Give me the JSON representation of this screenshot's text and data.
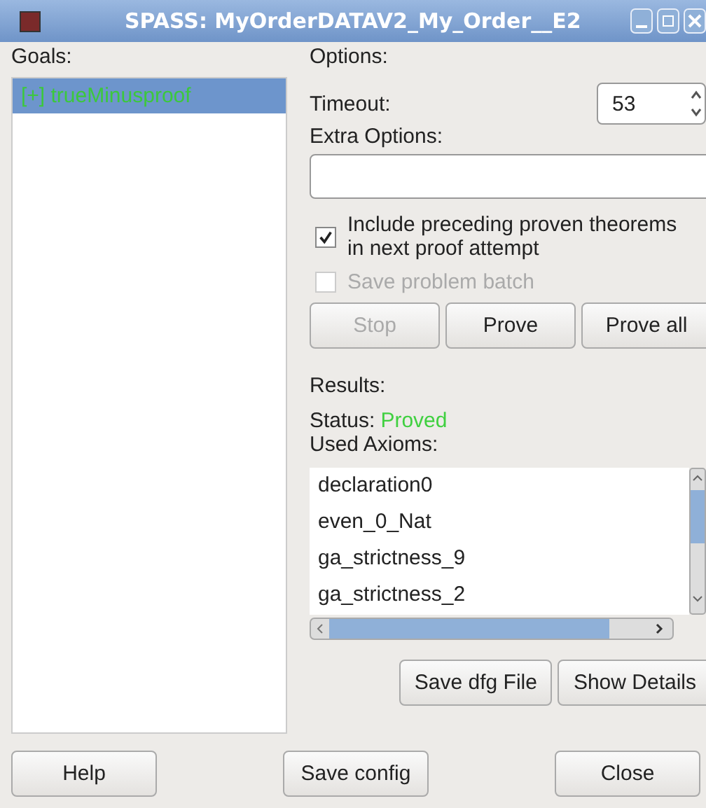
{
  "window": {
    "title": "SPASS: MyOrderDATAV2_My_Order__E2"
  },
  "goals": {
    "label": "Goals:",
    "items": [
      {
        "text": "[+] trueMinusproof",
        "selected": true
      }
    ]
  },
  "options": {
    "label": "Options:",
    "timeout": {
      "label": "Timeout:",
      "value": "53"
    },
    "extra_options": {
      "label": "Extra Options:"
    },
    "checkboxes": [
      {
        "label": "Include preceding proven theorems in next proof attempt",
        "checked": true,
        "disabled": false
      },
      {
        "label": "Save problem batch",
        "checked": false,
        "disabled": true
      }
    ],
    "buttons": [
      {
        "label": "Stop",
        "disabled": true
      },
      {
        "label": "Prove",
        "disabled": false
      },
      {
        "label": "Prove all",
        "disabled": false
      }
    ]
  },
  "results": {
    "label": "Results:",
    "status_label": "Status:",
    "status": "Proved",
    "axioms_label": "Used Axioms:",
    "axioms": [
      "declaration0",
      "even_0_Nat",
      "ga_strictness_9",
      "ga_strictness_2"
    ],
    "buttons": [
      "Save dfg File",
      "Show Details"
    ]
  },
  "footer": {
    "buttons": [
      "Help",
      "Save config",
      "Close"
    ]
  }
}
